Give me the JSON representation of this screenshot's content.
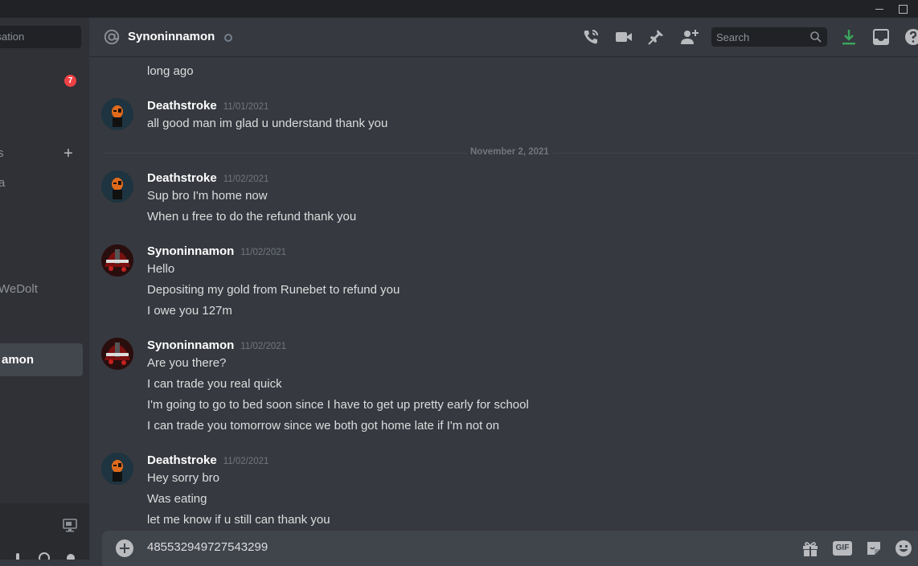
{
  "window": {
    "minimize_icon": "minimize-icon",
    "maximize_icon": "maximize-icon"
  },
  "sidebar": {
    "search_placeholder": "ersation",
    "badge_count": "7",
    "add_dm_icon": "plus-icon",
    "fragment_1": "s",
    "fragment_2": "a",
    "fragment_3": "WeDolt",
    "selected_dm_label": "amon",
    "screen_share_icon": "screen-share-icon"
  },
  "header": {
    "channel_icon": "at-sign-icon",
    "title": "Synoninnamon",
    "search_placeholder": "Search",
    "icons": [
      "call-icon",
      "video-icon",
      "pin-icon",
      "add-friend-icon",
      "search-icon",
      "download-icon",
      "inbox-icon",
      "help-icon"
    ]
  },
  "messages": {
    "top_cut_text": "long ago",
    "date_divider": "November 2, 2021",
    "groups": [
      {
        "author": "Deathstroke",
        "timestamp": "11/01/2021",
        "lines": [
          "all good man im glad u understand thank you"
        ]
      },
      {
        "author": "Deathstroke",
        "timestamp": "11/02/2021",
        "lines": [
          "Sup bro I'm home now",
          "When u free to do the refund thank you"
        ]
      },
      {
        "author": "Synoninnamon",
        "timestamp": "11/02/2021",
        "lines": [
          "Hello",
          "Depositing my gold from Runebet to refund you",
          "I owe you 127m"
        ]
      },
      {
        "author": "Synoninnamon",
        "timestamp": "11/02/2021",
        "lines": [
          "Are you there?",
          "I can trade you real quick",
          "I'm going to go to bed soon since I have to get up pretty early for school",
          "I can trade you tomorrow since we both got home late if I'm not on"
        ]
      },
      {
        "author": "Deathstroke",
        "timestamp": "11/02/2021",
        "lines": [
          "Hey sorry bro",
          "Was eating",
          "let me know if u still can thank you"
        ]
      }
    ]
  },
  "composer": {
    "value": "485532949727543299",
    "gif_label": "GIF",
    "icons": [
      "add-attachment-icon",
      "gift-icon",
      "gif-icon",
      "sticker-icon",
      "emoji-icon"
    ]
  },
  "colors": {
    "background": "#36393f",
    "sidebar": "#2f3136",
    "titlebar": "#202225",
    "badge": "#ed4245",
    "download_accent": "#3ba55d"
  }
}
